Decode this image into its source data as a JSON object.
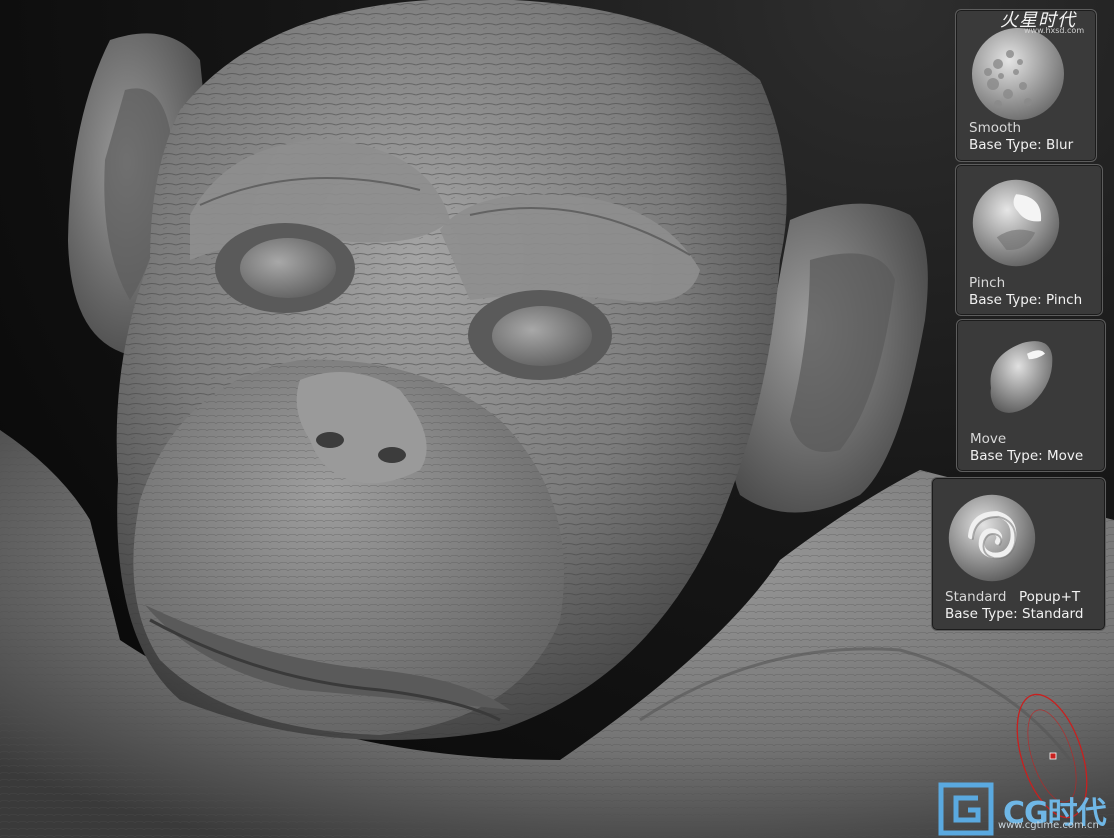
{
  "brushes": [
    {
      "name": "Smooth",
      "base_type": "Base Type: Blur",
      "hotkey": "",
      "icon": "smooth-brush-icon"
    },
    {
      "name": "Pinch",
      "base_type": "Base Type: Pinch",
      "hotkey": "",
      "icon": "pinch-brush-icon"
    },
    {
      "name": "Move",
      "base_type": "Base Type: Move",
      "hotkey": "",
      "icon": "move-brush-icon"
    },
    {
      "name": "Standard",
      "base_type": "Base Type: Standard",
      "hotkey": "Popup+T",
      "icon": "standard-brush-icon"
    }
  ],
  "watermarks": {
    "top_logo": "火星时代",
    "top_url": "www.hxsd.com",
    "bottom_logo": "CG时代",
    "bottom_url": "www.cgtime.com.cn"
  },
  "colors": {
    "panel_bg": "#3a3a3a",
    "panel_border": "#5d5d5d",
    "cursor_red": "#c8201f",
    "clay": "#8c8c8c"
  }
}
